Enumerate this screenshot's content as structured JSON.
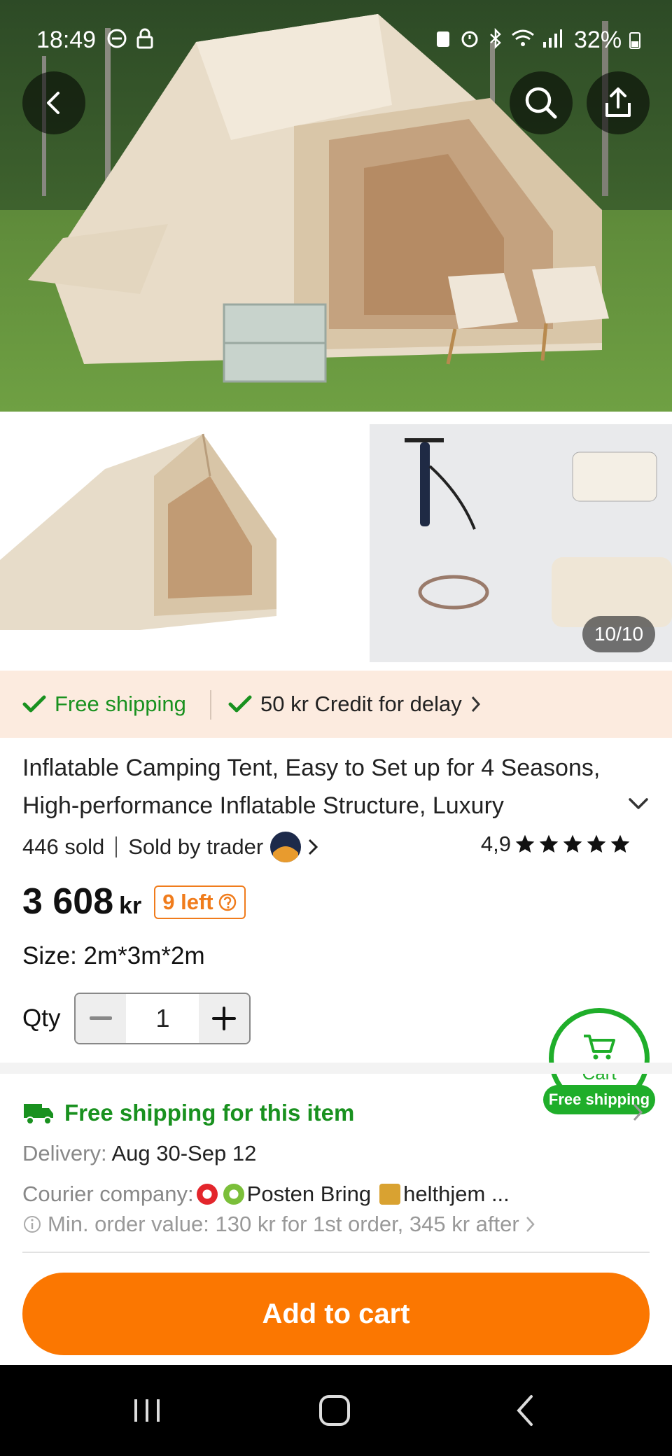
{
  "status_bar": {
    "time": "18:49",
    "battery": "32%"
  },
  "gallery": {
    "counter": "10/10"
  },
  "shipping_banner": {
    "free_shipping": "Free shipping",
    "credit": "50 kr Credit for delay"
  },
  "product": {
    "title_line1": "Inflatable Camping Tent, Easy to Set up for 4 Seasons,",
    "title_line2": "High-performance Inflatable Structure, Luxury",
    "sold": "446 sold",
    "sold_by": "Sold by trader",
    "rating": "4,9",
    "rating_stars": 5,
    "price": "3 608",
    "currency": "kr",
    "stock": "9 left",
    "size_label": "Size: 2m*3m*2m",
    "qty_label": "Qty",
    "qty_value": "1"
  },
  "floating_cart": {
    "label": "Cart",
    "tag": "Free shipping"
  },
  "shipping": {
    "title": "Free shipping for this item",
    "delivery_label": "Delivery: ",
    "delivery_value": "Aug 30-Sep 12",
    "courier_label": "Courier company: ",
    "courier_1": "Posten Bring",
    "courier_2": "helthjem ...",
    "min_order": "Min. order value: 130 kr for 1st order, 345 kr after"
  },
  "cta": {
    "add_to_cart": "Add to cart"
  },
  "colors": {
    "accent": "#fb7701",
    "green": "#19911f",
    "banner_bg": "#fcebdf"
  }
}
